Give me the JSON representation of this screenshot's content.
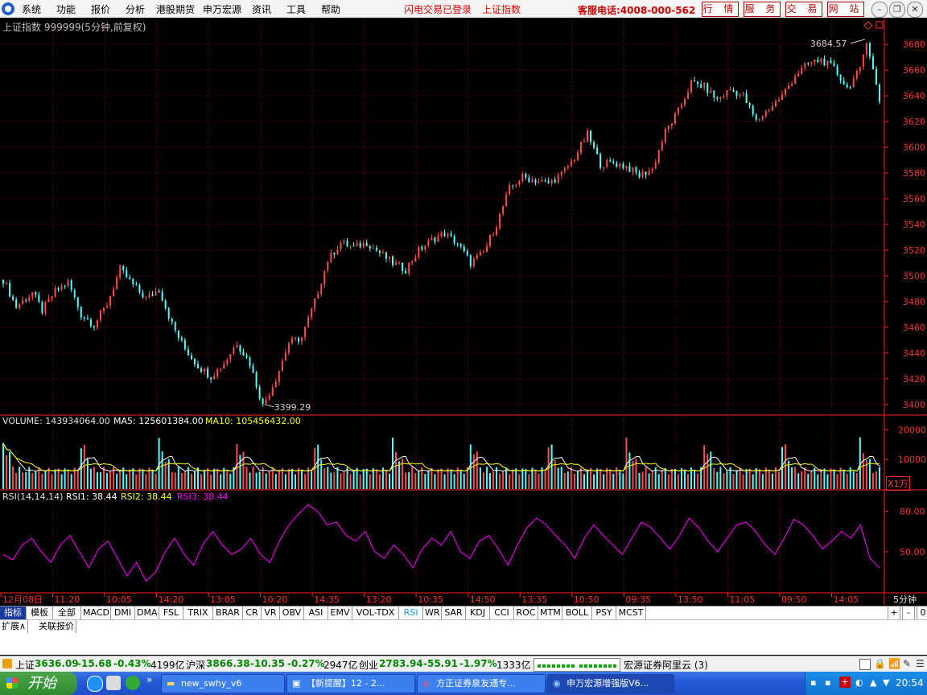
{
  "menu": {
    "items": [
      "系统",
      "功能",
      "报价",
      "分析",
      "港股期货",
      "申万宏源",
      "资讯",
      "工具",
      "帮助"
    ],
    "status1": "闪电交易已登录",
    "status2": "上证指数",
    "hotline": "客服电话:4008-000-562",
    "buttons": [
      "行 情",
      "服 务",
      "交 易",
      "网 站"
    ]
  },
  "colors": {
    "up": "#ff4d4d",
    "down": "#54ffff",
    "grid": "#8a0000",
    "axis": "#ff2020",
    "ma5": "#ffffff",
    "ma10": "#ffff00",
    "rsi": "#e000e0"
  },
  "chart_data": [
    {
      "type": "candlestick",
      "title": "上证指数 999999(5分钟,前复权)",
      "y_ticks": [
        3400,
        3420,
        3440,
        3460,
        3480,
        3500,
        3520,
        3540,
        3560,
        3580,
        3600,
        3620,
        3640,
        3660,
        3680
      ],
      "ylim": [
        3393,
        3692
      ],
      "annotations": [
        {
          "label": "3684.57",
          "value": 3684.57
        },
        {
          "label": "3399.29",
          "value": 3399.29
        }
      ],
      "close_path": [
        [
          0,
          3497
        ],
        [
          4,
          3476
        ],
        [
          9,
          3487
        ],
        [
          12,
          3473
        ],
        [
          16,
          3488
        ],
        [
          20,
          3495
        ],
        [
          24,
          3470
        ],
        [
          28,
          3462
        ],
        [
          32,
          3478
        ],
        [
          36,
          3505
        ],
        [
          40,
          3493
        ],
        [
          44,
          3482
        ],
        [
          48,
          3490
        ],
        [
          52,
          3462
        ],
        [
          56,
          3443
        ],
        [
          60,
          3430
        ],
        [
          64,
          3422
        ],
        [
          68,
          3432
        ],
        [
          72,
          3448
        ],
        [
          76,
          3432
        ],
        [
          80,
          3399
        ],
        [
          84,
          3420
        ],
        [
          88,
          3448
        ],
        [
          92,
          3452
        ],
        [
          96,
          3480
        ],
        [
          100,
          3512
        ],
        [
          104,
          3526
        ],
        [
          108,
          3522
        ],
        [
          112,
          3526
        ],
        [
          116,
          3518
        ],
        [
          120,
          3510
        ],
        [
          124,
          3505
        ],
        [
          128,
          3520
        ],
        [
          132,
          3528
        ],
        [
          136,
          3533
        ],
        [
          140,
          3525
        ],
        [
          144,
          3510
        ],
        [
          148,
          3518
        ],
        [
          152,
          3540
        ],
        [
          156,
          3568
        ],
        [
          160,
          3577
        ],
        [
          164,
          3574
        ],
        [
          168,
          3572
        ],
        [
          172,
          3579
        ],
        [
          176,
          3592
        ],
        [
          180,
          3610
        ],
        [
          184,
          3587
        ],
        [
          188,
          3588
        ],
        [
          192,
          3585
        ],
        [
          196,
          3578
        ],
        [
          200,
          3583
        ],
        [
          204,
          3612
        ],
        [
          208,
          3628
        ],
        [
          212,
          3650
        ],
        [
          216,
          3647
        ],
        [
          220,
          3637
        ],
        [
          224,
          3645
        ],
        [
          228,
          3640
        ],
        [
          232,
          3620
        ],
        [
          236,
          3630
        ],
        [
          240,
          3640
        ],
        [
          244,
          3656
        ],
        [
          248,
          3665
        ],
        [
          252,
          3668
        ],
        [
          256,
          3661
        ],
        [
          260,
          3646
        ],
        [
          264,
          3660
        ],
        [
          266,
          3684
        ],
        [
          268,
          3660
        ],
        [
          270,
          3636
        ]
      ]
    },
    {
      "type": "bar",
      "title": "VOLUME",
      "header": {
        "volume_label": "VOLUME: 143934064.00",
        "ma5_label": "MA5: 125601384.00",
        "ma10_label": "MA10: 105456432.00"
      },
      "y_ticks": [
        10000,
        20000
      ],
      "ylim": [
        0,
        22000
      ],
      "unit_label": "X1万",
      "spike_interval": 24,
      "baseline": 5000,
      "spike_peak": 13500
    },
    {
      "type": "line",
      "title": "RSI",
      "header": {
        "rsi_label": "RSI(14,14,14)",
        "rsi1": "RSI1: 38.44",
        "rsi2": "RSI2: 38.44",
        "rsi3": "RSI3: 38.44"
      },
      "y_ticks": [
        50.0,
        80.0
      ],
      "ylim": [
        20,
        90
      ],
      "values": [
        48,
        44,
        55,
        60,
        50,
        42,
        55,
        62,
        50,
        38,
        52,
        58,
        45,
        32,
        42,
        28,
        35,
        50,
        60,
        48,
        40,
        56,
        65,
        55,
        48,
        52,
        60,
        48,
        42,
        58,
        70,
        78,
        85,
        80,
        70,
        72,
        62,
        58,
        65,
        50,
        45,
        55,
        48,
        38,
        52,
        60,
        55,
        65,
        50,
        45,
        58,
        62,
        52,
        40,
        55,
        68,
        75,
        70,
        62,
        55,
        45,
        60,
        70,
        62,
        55,
        48,
        60,
        72,
        68,
        60,
        52,
        62,
        75,
        68,
        58,
        50,
        60,
        70,
        72,
        65,
        55,
        48,
        60,
        74,
        70,
        62,
        52,
        58,
        65,
        60,
        70,
        45,
        38
      ]
    }
  ],
  "time_axis": {
    "labels": [
      "12月08日",
      "11:20",
      "10:05",
      "14:20",
      "13:05",
      "10:20",
      "14:35",
      "13:20",
      "10:35",
      "14:50",
      "13:35",
      "10:50",
      "09:35",
      "13:50",
      "11:05",
      "09:50",
      "14:05"
    ]
  },
  "period_label": "5分钟",
  "tabs": [
    "指标",
    "模板",
    "全部",
    "MACD",
    "DMI",
    "DMA",
    "FSL",
    "TRIX",
    "BRAR",
    "CR",
    "VR",
    "OBV",
    "ASI",
    "EMV",
    "VOL-TDX",
    "RSI",
    "WR",
    "SAR",
    "KDJ",
    "CCI",
    "ROC",
    "MTM",
    "BOLL",
    "PSY",
    "MCST"
  ],
  "tab_controls": [
    "+",
    "-",
    "0"
  ],
  "ext_tabs": [
    "扩展∧",
    "关联报价"
  ],
  "statusbar": {
    "sh_label": "上证",
    "sh_value": "3636.09",
    "sh_change": "-15.68",
    "sh_pct": "-0.43%",
    "sh_amount": "4199亿",
    "hs_label": "沪深",
    "hs_value": "3866.38",
    "hs_change": "-10.35",
    "hs_pct": "-0.27%",
    "hs_amount": "2947亿",
    "cy_label": "创业",
    "cy_value": "2783.94",
    "cy_change": "-55.91",
    "cy_pct": "-1.97%",
    "cy_amount": "1333亿",
    "server": "宏源证券阿里云 (3)"
  },
  "taskbar": {
    "start": "开始",
    "tasks": [
      "new_swhy_v6",
      "【新提醒】12 - 2...",
      "方正证券泉友通专...",
      "申万宏源增强版V6..."
    ],
    "time": "20:54"
  }
}
